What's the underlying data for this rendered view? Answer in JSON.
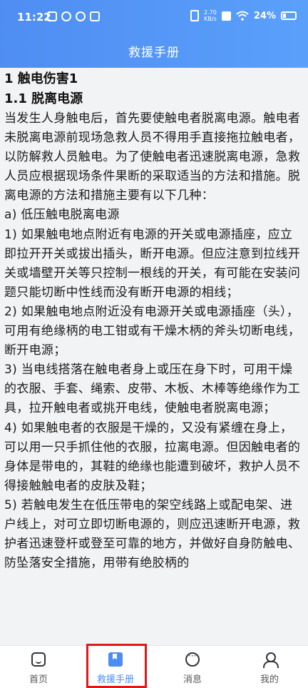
{
  "status_bar": {
    "time": "11:22",
    "net_speed_value": "2.70",
    "net_speed_unit": "KB/s",
    "battery": "24%"
  },
  "header": {
    "title": "救援手册"
  },
  "content": {
    "heading1": "1 触电伤害1",
    "heading2": "1.1 脱离电源",
    "paragraphs": [
      "当发生人身触电后，首先要使触电者脱离电源。触电者未脱离电源前现场急救人员不得用手直接拖拉触电者，以防解救人员触电。为了使触电者迅速脱离电源，急救人员应根据现场条件果断的采取适当的方法和措施。脱离电源的方法和措施主要有以下几种：",
      "a) 低压触电脱离电源",
      "1) 如果触电地点附近有电源的开关或电源插座，应立即拉开开关或拔出插头，断开电源。但应注意到拉线开关或墙壁开关等只控制一根线的开关，有可能在安装问题只能切断中性线而没有断开电源的相线；",
      "2) 如果触电地点附近没有电源开关或电源插座（头），可用有绝缘柄的电工钳或有干燥木柄的斧头切断电线，断开电源；",
      "3) 当电线搭落在触电者身上或压在身下时，可用干燥的衣服、手套、绳索、皮带、木板、木棒等绝缘作为工具，拉开触电者或挑开电线，使触电者脱离电源；",
      "4) 如果触电者的衣服是干燥的，又没有紧缠在身上，可以用一只手抓住他的衣服，拉离电源。但因触电者的身体是带电的，其鞋的绝缘也能遭到破坏，救护人员不得接触触电者的皮肤及鞋；",
      "5) 若触电发生在低压带电的架空线路上或配电架、进户线上，对可立即切断电源的，则应迅速断开电源，救护者迅速登杆或登至可靠的地方，并做好自身防触电、防坠落安全措施，用带有绝胶柄的"
    ]
  },
  "bottom_nav": {
    "tabs": [
      {
        "label": "首页",
        "icon": "home-icon"
      },
      {
        "label": "救援手册",
        "icon": "book-icon"
      },
      {
        "label": "消息",
        "icon": "message-icon"
      },
      {
        "label": "我的",
        "icon": "user-icon"
      }
    ],
    "active_index": 1
  },
  "colors": {
    "header": "#5a9bf8",
    "active_tab": "#4a8df5",
    "content_bg": "#f2f3f5",
    "highlight_box": "#e01818"
  }
}
